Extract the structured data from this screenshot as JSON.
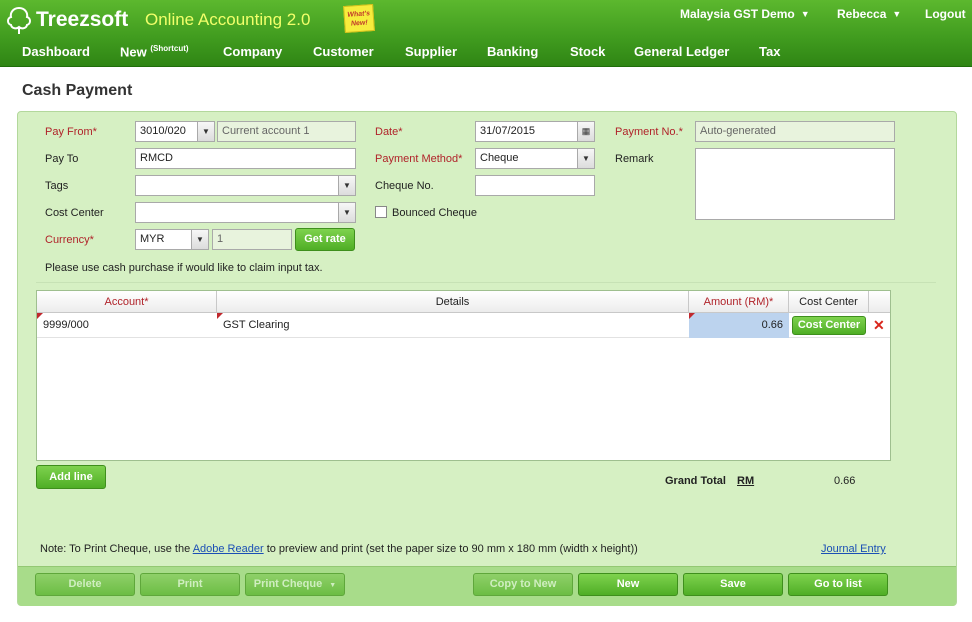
{
  "header": {
    "brand": "Treezsoft",
    "subtitle": "Online Accounting 2.0",
    "whats_new_line1": "What's",
    "whats_new_line2": "New!",
    "company": "Malaysia GST Demo",
    "user": "Rebecca",
    "logout": "Logout"
  },
  "nav": {
    "items": [
      "Dashboard",
      "New",
      "Company",
      "Customer",
      "Supplier",
      "Banking",
      "Stock",
      "General Ledger",
      "Tax"
    ],
    "new_sup": "(Shortcut)"
  },
  "page": {
    "title": "Cash Payment"
  },
  "form": {
    "pay_from_label": "Pay From*",
    "pay_from_code": "3010/020",
    "pay_from_name": "Current account 1",
    "pay_to_label": "Pay To",
    "pay_to_value": "RMCD",
    "tags_label": "Tags",
    "cost_center_label": "Cost Center",
    "currency_label": "Currency*",
    "currency_value": "MYR",
    "rate_value": "1",
    "get_rate": "Get rate",
    "note": "Please use cash purchase if would like to claim input tax.",
    "date_label": "Date*",
    "date_value": "31/07/2015",
    "payment_method_label": "Payment Method*",
    "payment_method_value": "Cheque",
    "cheque_no_label": "Cheque No.",
    "bounced_label": "Bounced Cheque",
    "payment_no_label": "Payment No.*",
    "payment_no_value": "Auto-generated",
    "remark_label": "Remark"
  },
  "grid": {
    "headers": [
      "Account*",
      "Details",
      "Amount (RM)*",
      "Cost Center"
    ],
    "rows": [
      {
        "account": "9999/000",
        "details": "GST Clearing",
        "amount": "0.66",
        "cost_center_btn": "Cost Center"
      }
    ]
  },
  "add_line": "Add line",
  "totals": {
    "label": "Grand Total",
    "currency": "RM",
    "value": "0.66"
  },
  "footer_note": {
    "before": "Note: To Print Cheque, use the ",
    "link": "Adobe Reader",
    "after": " to preview and print (set the paper size to 90 mm x 180 mm (width x height))",
    "journal": "Journal Entry"
  },
  "buttons": {
    "delete": "Delete",
    "print": "Print",
    "print_cheque": "Print Cheque",
    "copy_to_new": "Copy to New",
    "new": "New",
    "save": "Save",
    "go_to_list": "Go to list"
  },
  "colors": {
    "brand_green": "#4caf23",
    "panel_bg": "#d6f0c3",
    "required_red": "#b0232a"
  }
}
